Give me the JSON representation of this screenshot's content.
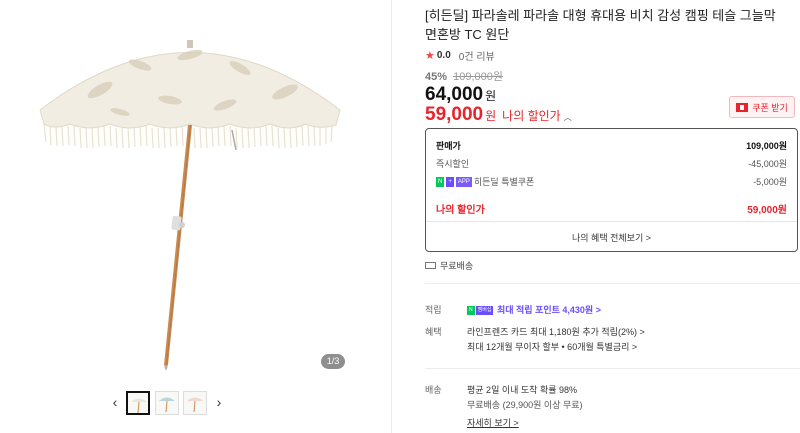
{
  "gallery": {
    "page_indicator": "1/3",
    "prev_arrow": "‹",
    "next_arrow": "›"
  },
  "product": {
    "title": "[히든딜] 파라솔레 파라솔 대형 휴대용 비치 감성 캠핑 테슬 그늘막 면혼방 TC 원단",
    "rating_score": "0.0",
    "review_count": "0건 리뷰",
    "discount_pct": "45%",
    "original_price": "109,000원",
    "price": "64,000",
    "price_unit": "원",
    "my_price": "59,000",
    "my_price_unit": "원",
    "my_price_label": "나의 할인가",
    "coupon_button": "쿠폰 받기"
  },
  "price_box": {
    "sale_label": "판매가",
    "sale_value": "109,000원",
    "instant_label": "즉시할인",
    "instant_value": "-45,000원",
    "coupon_badge_n": "N",
    "coupon_badge_plus": "+",
    "coupon_badge_app": "APP",
    "coupon_label": "히든딜 특별쿠폰",
    "coupon_value": "-5,000원",
    "my_label": "나의 할인가",
    "my_value": "59,000원",
    "benefits_link": "나의 혜택 전체보기 >"
  },
  "shipping_free": "무료배송",
  "points": {
    "label": "적립",
    "badge_n": "N",
    "badge_plus": "멤버십",
    "text": "최대 적립 포인트 4,430원 >"
  },
  "benefits": {
    "label": "혜택",
    "line1": "라인프렌즈 카드 최대 1,180원 추가 적립(2%) >",
    "line2": "최대 12개월 무이자 할부 • 60개월 특별금리 >"
  },
  "delivery": {
    "label": "배송",
    "line1": "평균 2일 이내 도착 확률 98%",
    "line2": "무료배송 (29,900원 이상 무료)",
    "details_link": "자세히 보기 >"
  },
  "colors": {
    "accent_red": "#e8232b",
    "naver_green": "#03c75a",
    "membership_purple": "#6a4dff"
  }
}
